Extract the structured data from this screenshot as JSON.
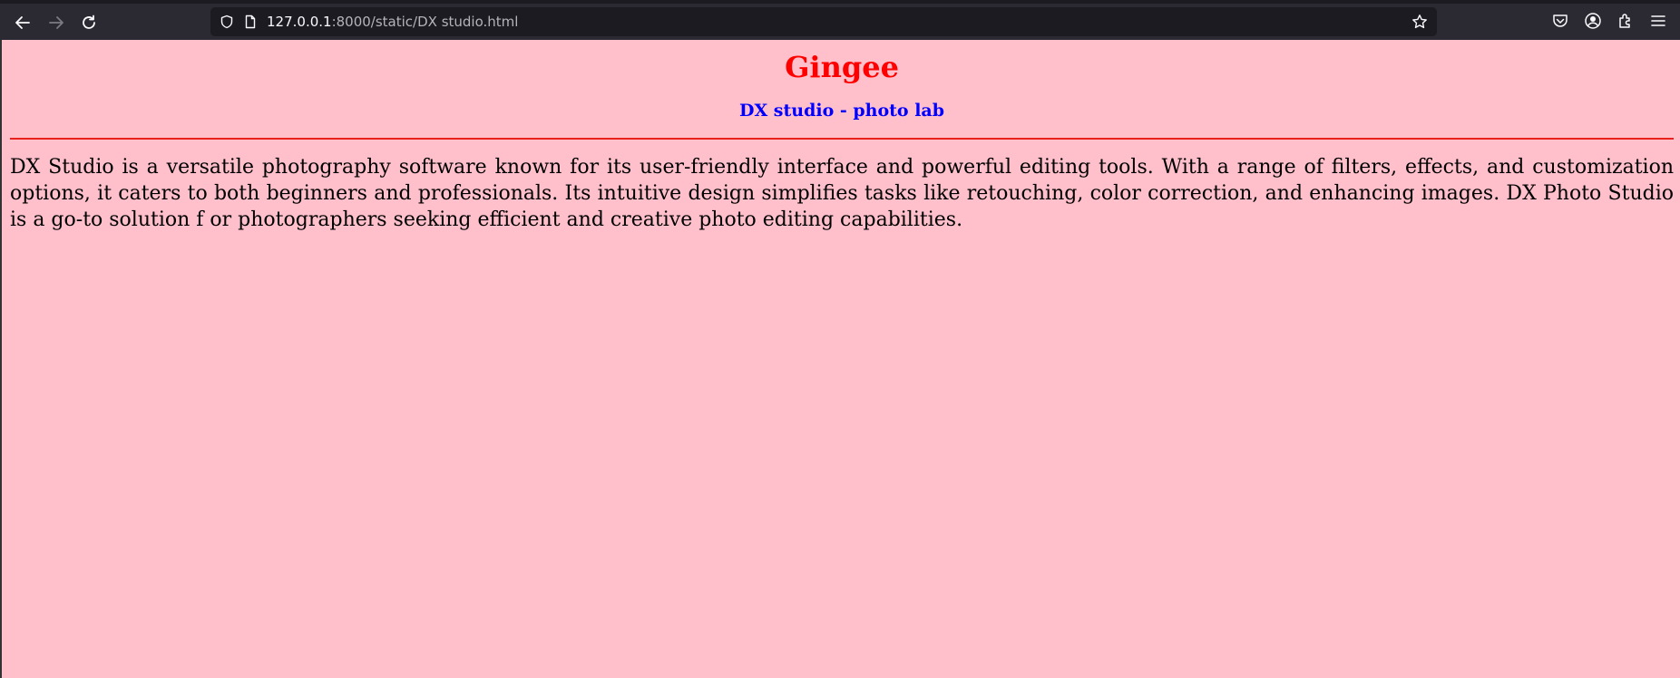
{
  "browser": {
    "url_host": "127.0.0.1",
    "url_rest": ":8000/static/DX studio.html"
  },
  "page": {
    "title": "Gingee",
    "subtitle": "DX studio - photo lab",
    "paragraph": "DX Studio is a versatile photography software known for its user-friendly interface and powerful editing tools. With a range of filters, effects, and customization options, it caters to both beginners and professionals. Its intuitive design simplifies tasks like retouching, color correction, and enhancing images. DX Photo Studio is a go-to solution f or photographers seeking efficient and creative photo editing capabilities."
  },
  "colors": {
    "background": "#ffc0cb",
    "title": "#ff0000",
    "subtitle": "#0000ff",
    "rule": "#e8211d"
  },
  "icons": [
    "back-arrow-icon",
    "forward-arrow-icon",
    "reload-icon",
    "shield-icon",
    "page-icon",
    "bookmark-star-icon",
    "pocket-icon",
    "account-icon",
    "extensions-icon",
    "menu-icon"
  ]
}
